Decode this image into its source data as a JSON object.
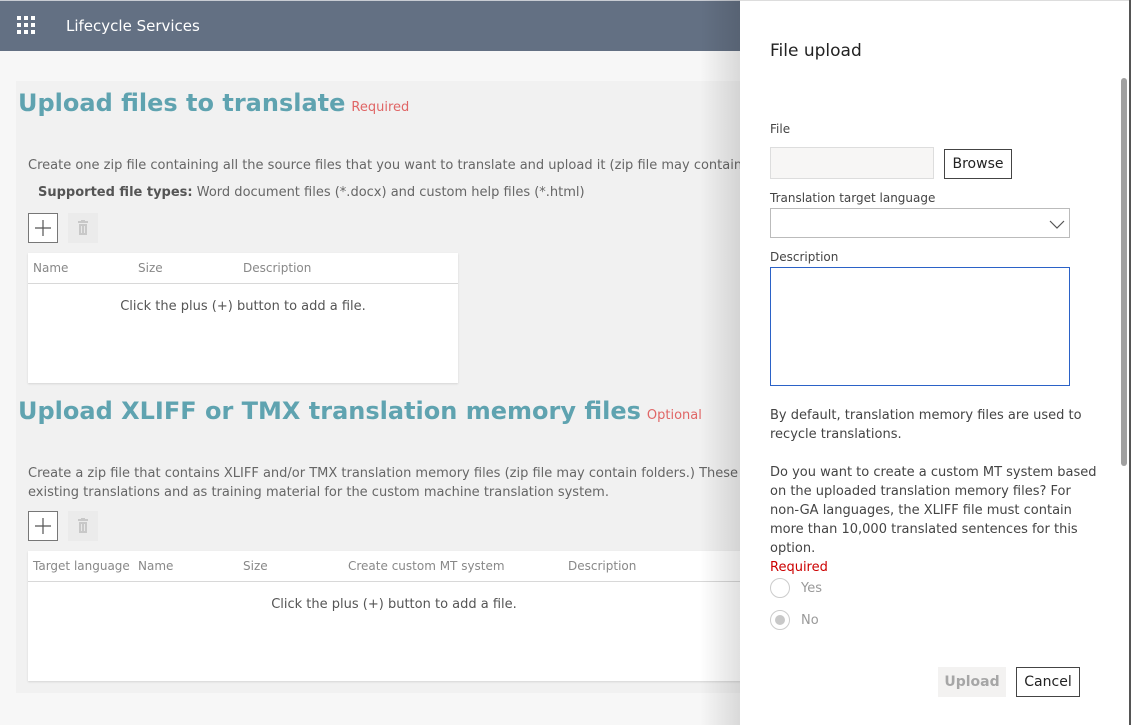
{
  "header": {
    "app_title": "Lifecycle Services",
    "waffle_icon": "app-launcher-icon"
  },
  "section1": {
    "title": "Upload files to translate",
    "tag": "Required",
    "description": "Create one zip file containing all the source files that you want to translate and upload it (zip file may contain folder",
    "supported_label": "Supported file types:",
    "supported_value": "Word document files (*.docx) and custom help files (*.html)",
    "columns": [
      "Name",
      "Size",
      "Description"
    ],
    "empty_message": "Click the plus (+) button to add a file."
  },
  "section2": {
    "title": "Upload XLIFF or TMX translation memory files",
    "tag": "Optional",
    "description_line1": "Create a zip file that contains XLIFF and/or TMX translation memory files (zip file may contain folders.) These files ca",
    "description_line2": "existing translations and as training material for the custom machine translation system.",
    "columns": [
      "Target language",
      "Name",
      "Size",
      "Create custom MT system",
      "Description"
    ],
    "empty_message": "Click the plus (+) button to add a file."
  },
  "panel": {
    "title": "File upload",
    "file_label": "File",
    "file_value": "",
    "browse_label": "Browse",
    "language_label": "Translation target language",
    "language_value": "",
    "description_label": "Description",
    "description_value": "",
    "info_text": "By default, translation memory files are used to recycle translations.",
    "question_text": "Do you want to create a custom MT system based on the uploaded translation memory files? For non-GA languages, the XLIFF file must contain more than 10,000 translated sentences for this option.",
    "required_label": "Required",
    "options": [
      {
        "label": "Yes",
        "selected": false
      },
      {
        "label": "No",
        "selected": true
      }
    ],
    "upload_label": "Upload",
    "cancel_label": "Cancel"
  },
  "colors": {
    "header_bg": "#637083",
    "section_title": "#5fa3b0",
    "tag_red": "#e06666",
    "required_red": "#cc0000",
    "focus_blue": "#2b62c7"
  }
}
